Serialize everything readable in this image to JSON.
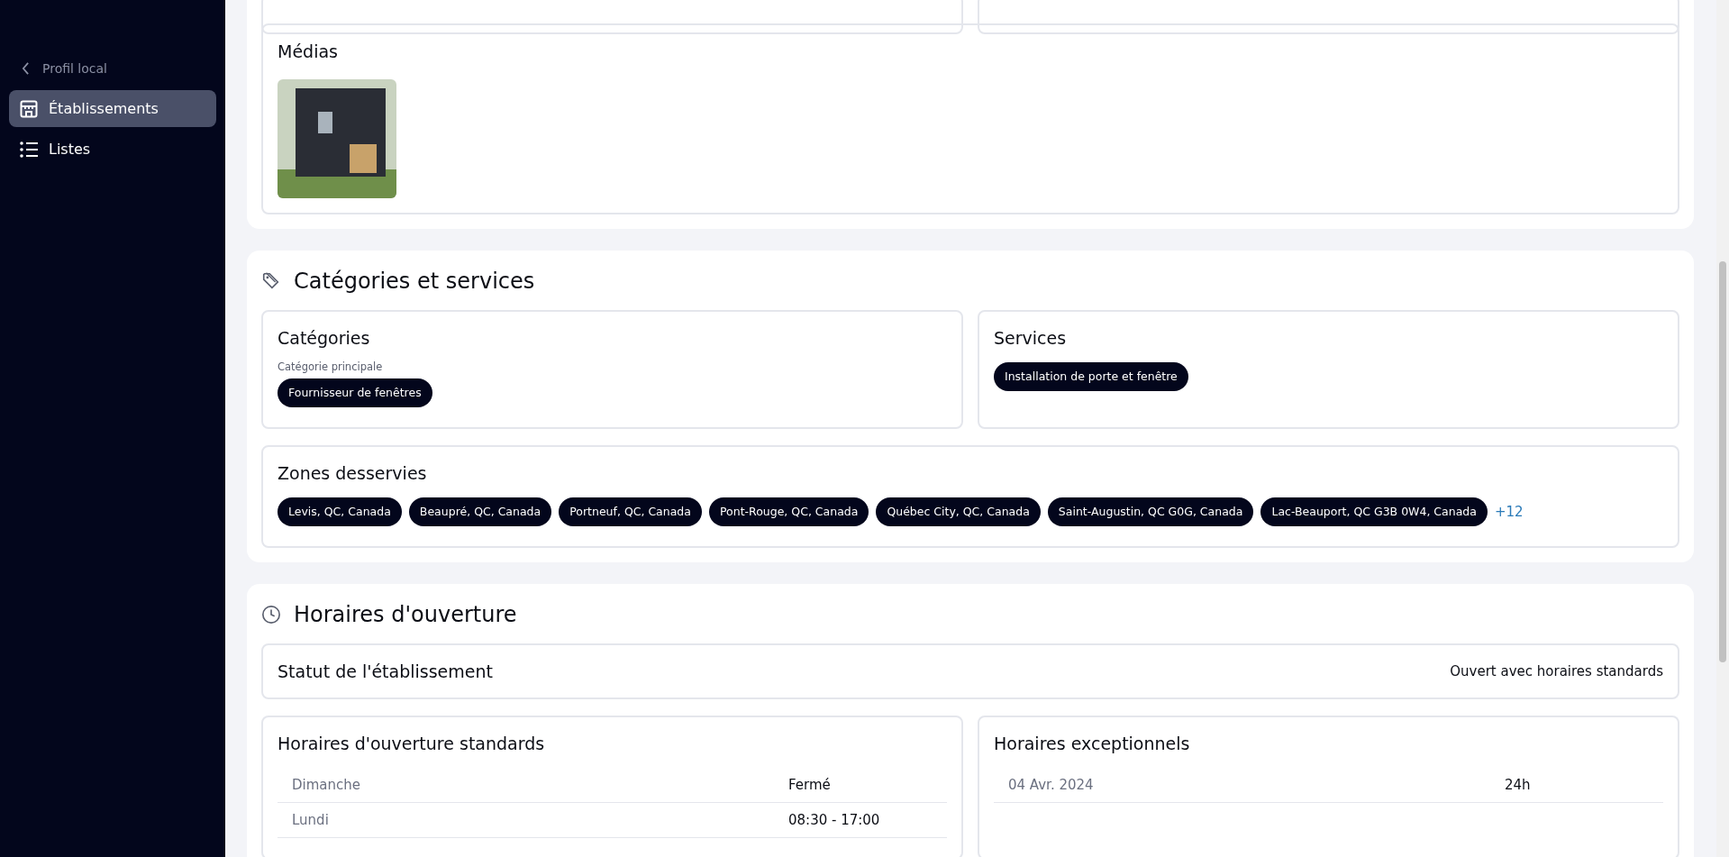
{
  "sidebar": {
    "back_link": "Profil local",
    "items": [
      {
        "label": "Établissements",
        "selected": true
      },
      {
        "label": "Listes",
        "selected": false
      }
    ]
  },
  "media": {
    "title": "Médias"
  },
  "categories_section": {
    "title": "Catégories et services",
    "categories": {
      "title": "Catégories",
      "primary_label": "Catégorie principale",
      "primary": "Fournisseur de fenêtres"
    },
    "services": {
      "title": "Services",
      "tags": [
        "Installation de porte et fenêtre"
      ]
    },
    "zones": {
      "title": "Zones desservies",
      "tags": [
        "Levis, QC, Canada",
        "Beaupré, QC, Canada",
        "Portneuf, QC, Canada",
        "Pont-Rouge, QC, Canada",
        "Québec City, QC, Canada",
        "Saint-Augustin, QC G0G, Canada",
        "Lac-Beauport, QC G3B 0W4, Canada"
      ],
      "more": "+12"
    }
  },
  "hours_section": {
    "title": "Horaires d'ouverture",
    "status": {
      "label": "Statut de l'établissement",
      "value": "Ouvert avec horaires standards"
    },
    "standard": {
      "title": "Horaires d'ouverture standards",
      "rows": [
        {
          "day": "Dimanche",
          "hours": "Fermé"
        },
        {
          "day": "Lundi",
          "hours": "08:30 - 17:00"
        }
      ]
    },
    "exceptional": {
      "title": "Horaires exceptionnels",
      "rows": [
        {
          "date": "04 Avr. 2024",
          "hours": "24h"
        }
      ]
    }
  }
}
